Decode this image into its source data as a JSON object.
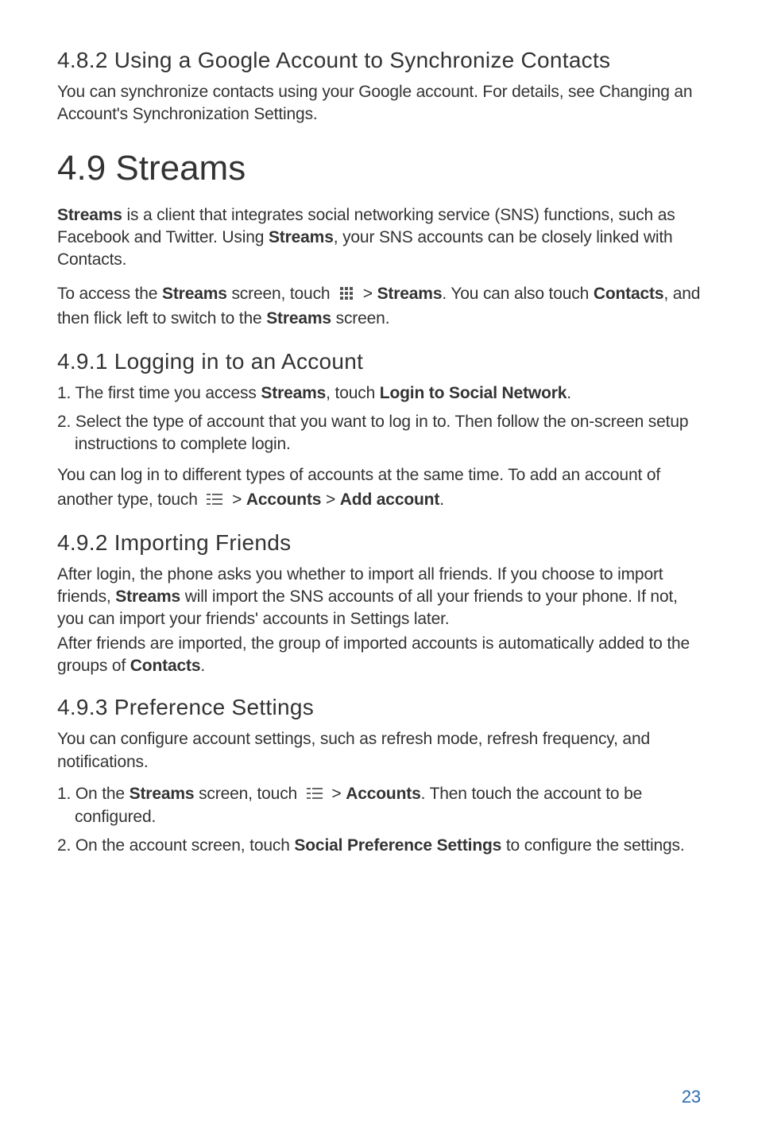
{
  "sec482": {
    "heading": "4.8.2  Using a Google Account to Synchronize Contacts",
    "p1": "You can synchronize contacts using your Google account. For details, see Changing an Account's Synchronization Settings."
  },
  "sec49": {
    "heading": "4.9  Streams",
    "intro_pre": "Streams",
    "intro_mid1": " is a client that integrates social networking service (SNS) functions, such as Facebook and Twitter. Using ",
    "intro_bold2": "Streams",
    "intro_mid2": ", your SNS accounts can be closely linked with Contacts.",
    "access_pre": "To access the ",
    "access_b1": "Streams",
    "access_mid1": " screen, touch ",
    "gt1": " > ",
    "access_b2": "Streams",
    "access_mid2": ". You can also touch ",
    "access_b3": "Contacts",
    "access_mid3": ", and then flick left to switch to the ",
    "access_b4": "Streams",
    "access_mid4": " screen."
  },
  "sec491": {
    "heading": "4.9.1  Logging in to an Account",
    "li1_pre": "1. The first time you access ",
    "li1_b1": "Streams",
    "li1_mid": ", touch ",
    "li1_b2": "Login to Social Network",
    "li1_post": ".",
    "li2": "2. Select the type of account that you want to log in to. Then follow the on-screen setup instructions to complete login.",
    "after_pre": "You can log in to different types of accounts at the same time. To add an account of another type, touch ",
    "after_gt1": " > ",
    "after_b1": "Accounts",
    "after_gt2": " > ",
    "after_b2": "Add account",
    "after_post": "."
  },
  "sec492": {
    "heading": "4.9.2  Importing Friends",
    "p1_pre": "After login, the phone asks you whether to import all friends. If you choose to import friends, ",
    "p1_b1": "Streams",
    "p1_post": " will import the SNS accounts of all your friends to your phone. If not, you can import your friends' accounts in Settings later.",
    "p2_pre": "After friends are imported, the group of imported accounts is automatically added to the groups of ",
    "p2_b1": "Contacts",
    "p2_post": "."
  },
  "sec493": {
    "heading": "4.9.3  Preference Settings",
    "p1": "You can configure account settings, such as refresh mode, refresh frequency, and notifications.",
    "li1_pre": "1. On the ",
    "li1_b1": "Streams",
    "li1_mid1": " screen, touch ",
    "li1_gt": " > ",
    "li1_b2": "Accounts",
    "li1_post": ". Then touch the account to be configured.",
    "li2_pre": "2. On the account screen, touch ",
    "li2_b1": "Social Preference Settings",
    "li2_post": " to configure the settings."
  },
  "page_number": "23"
}
